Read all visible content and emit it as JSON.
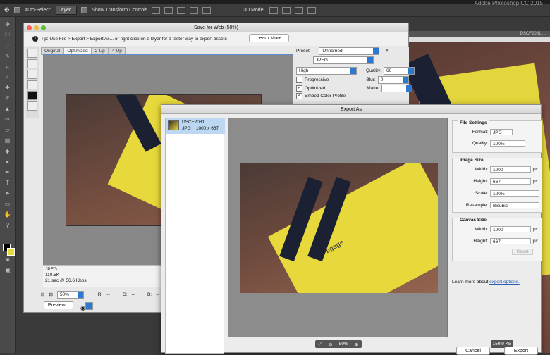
{
  "app": {
    "title": "Adobe Photoshop CC 2015"
  },
  "options_bar": {
    "auto_select_label": "Auto-Select:",
    "auto_select_value": "Layer",
    "transform_label": "Show Transform Controls",
    "mode_3d_label": "3D Mode:"
  },
  "bg_doc": {
    "tab_label": "DSCF2081 ..."
  },
  "save_for_web": {
    "title": "Save for Web (50%)",
    "tip": "Tip: Use File > Export > Export As...  or right click on a layer for a faster way to export assets",
    "learn_more": "Learn More",
    "tabs": [
      "Original",
      "Optimized",
      "2-Up",
      "4-Up"
    ],
    "preset_label": "Preset:",
    "preset_value": "[Unnamed]",
    "format_value": "JPEG",
    "quality_level": "High",
    "quality_label": "Quality:",
    "quality_value": "60",
    "progressive_label": "Progressive",
    "blur_label": "Blur:",
    "blur_value": "0",
    "optimized_label": "Optimized",
    "matte_label": "Matte:",
    "embed_label": "Embed Color Profile",
    "info_format": "JPEG",
    "info_size": "110.5K",
    "info_time": "21 sec @ 56.6 Kbps",
    "zoom_value": "50%",
    "r_label": "R:",
    "r_value": "--",
    "g_label": "G:",
    "g_value": "--",
    "b_label": "B:",
    "b_value": "--",
    "preview_btn": "Preview..."
  },
  "export_as": {
    "title": "Export As",
    "item_name": "DSCF2081",
    "item_format": "JPG",
    "item_dims": "1000 x 667",
    "image_word": "engage",
    "file_size": "159.9 KB",
    "zoom": "50%",
    "file_settings": {
      "header": "File Settings",
      "format_label": "Format:",
      "format_value": "JPG",
      "quality_label": "Quality:",
      "quality_value": "100%"
    },
    "image_size": {
      "header": "Image Size",
      "width_label": "Width:",
      "width_value": "1000",
      "height_label": "Height:",
      "height_value": "667",
      "scale_label": "Scale:",
      "scale_value": "100%",
      "resample_label": "Resample:",
      "resample_value": "Bicubic",
      "unit": "px"
    },
    "canvas_size": {
      "header": "Canvas Size",
      "width_label": "Width:",
      "width_value": "1000",
      "height_label": "Height:",
      "height_value": "667",
      "unit": "px",
      "reset": "Reset"
    },
    "learn_prefix": "Learn more about ",
    "learn_link": "export options.",
    "cancel": "Cancel",
    "export": "Export"
  }
}
